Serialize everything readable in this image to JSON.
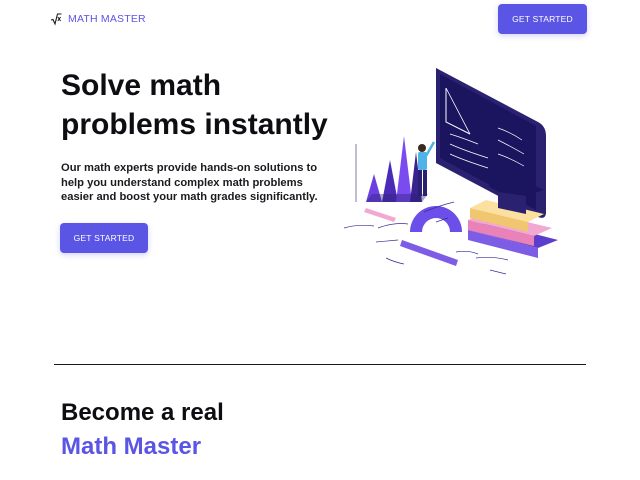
{
  "brand": {
    "name": "MATH MASTER",
    "icon": "sqrt-x-icon",
    "accent_color": "#5b55e6"
  },
  "nav": {
    "cta_label": "GET STARTED"
  },
  "hero": {
    "title": "Solve math problems instantly",
    "description": "Our math experts provide hands-on solutions to help you understand complex math problems easier and boost your math grades significantly.",
    "cta_label": "GET STARTED"
  },
  "section": {
    "title": "Become a real",
    "accent_title": "Math Master"
  }
}
